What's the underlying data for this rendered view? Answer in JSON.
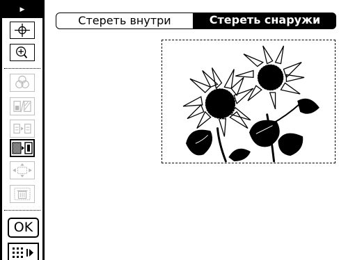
{
  "sidebar": {
    "ok_label": "OK",
    "tools": [
      {
        "name": "move-crosshair-icon",
        "enabled": true
      },
      {
        "name": "zoom-in-icon",
        "enabled": true
      },
      {
        "name": "multi-layer-icon",
        "enabled": false
      },
      {
        "name": "split-fill-icon",
        "enabled": false
      },
      {
        "name": "document-to-document-icon",
        "enabled": false
      },
      {
        "name": "erase-pattern-icon",
        "enabled": true,
        "selected": true
      },
      {
        "name": "resize-arrows-icon",
        "enabled": false
      },
      {
        "name": "trash-icon",
        "enabled": false
      }
    ]
  },
  "tabs": {
    "erase_inside": "Стереть внутри",
    "erase_outside": "Стереть снаружи",
    "active": "erase_outside"
  },
  "preview": {
    "subject": "sunflowers-image"
  }
}
